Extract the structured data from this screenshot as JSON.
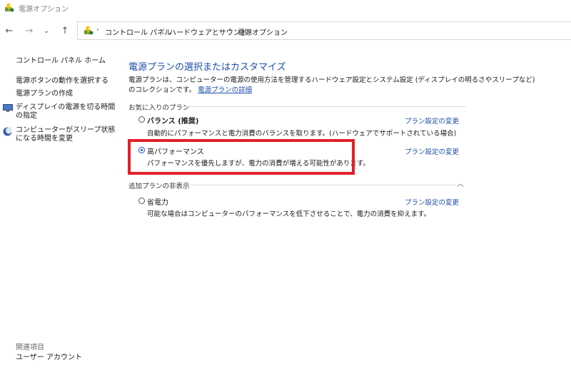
{
  "window": {
    "title": "電源オプション"
  },
  "breadcrumb": {
    "items": [
      "コントロール パネル",
      "ハードウェアとサウンド",
      "電源オプション"
    ],
    "separator": "›"
  },
  "nav": {
    "back": "←",
    "forward": "→",
    "recent": "⌄",
    "up": "↑"
  },
  "sidebar": {
    "home": "コントロール パネル ホーム",
    "links": [
      "電源ボタンの動作を選択する",
      "電源プランの作成",
      "ディスプレイの電源を切る時間の指定",
      "コンピューターがスリープ状態になる時間を変更"
    ],
    "related_title": "関連項目",
    "related_links": [
      "ユーザー アカウント"
    ]
  },
  "main": {
    "title": "電源プランの選択またはカスタマイズ",
    "description_line1": "電源プランは、コンピューターの電源の使用方法を管理するハードウェア設定とシステム設定 (ディスプレイの明るさやスリープなど)",
    "description_line2": "のコレクションです。",
    "description_link": "電源プランの詳細",
    "favorites_header": "お気に入りのプラン",
    "hidden_header": "追加プランの非表示",
    "plans": [
      {
        "name": "バランス (推奨)",
        "description": "自動的にパフォーマンスと電力消費のバランスを取ります。(ハードウェアでサポートされている場合)",
        "link": "プラン設定の変更",
        "selected": false
      },
      {
        "name": "高パフォーマンス",
        "description": "パフォーマンスを優先しますが、電力の消費が増える可能性があります。",
        "link": "プラン設定の変更",
        "selected": true
      },
      {
        "name": "省電力",
        "description": "可能な場合はコンピューターのパフォーマンスを低下させることで、電力の消費を抑えます。",
        "link": "プラン設定の変更",
        "selected": false
      }
    ]
  },
  "colors": {
    "link": "#1e4fa8",
    "highlight": "#e0202a",
    "radio_selected": "#1a4fc4"
  }
}
